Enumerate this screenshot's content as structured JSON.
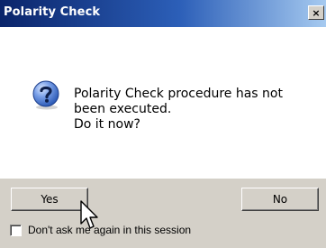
{
  "dialog": {
    "title": "Polarity Check",
    "close_label": "×",
    "message_lines": [
      "Polarity Check procedure has not",
      "been executed.",
      "Do it now?"
    ],
    "icon": "question-icon"
  },
  "buttons": {
    "yes_label": "Yes",
    "no_label": "No"
  },
  "checkbox": {
    "label": "Don't ask me again in this session",
    "checked": false
  },
  "colors": {
    "titlebar_start": "#0a246a",
    "titlebar_end": "#a6caf0",
    "dialog_face": "#d4d0c8",
    "content_bg": "#ffffff",
    "icon_blue": "#2f5db8"
  }
}
